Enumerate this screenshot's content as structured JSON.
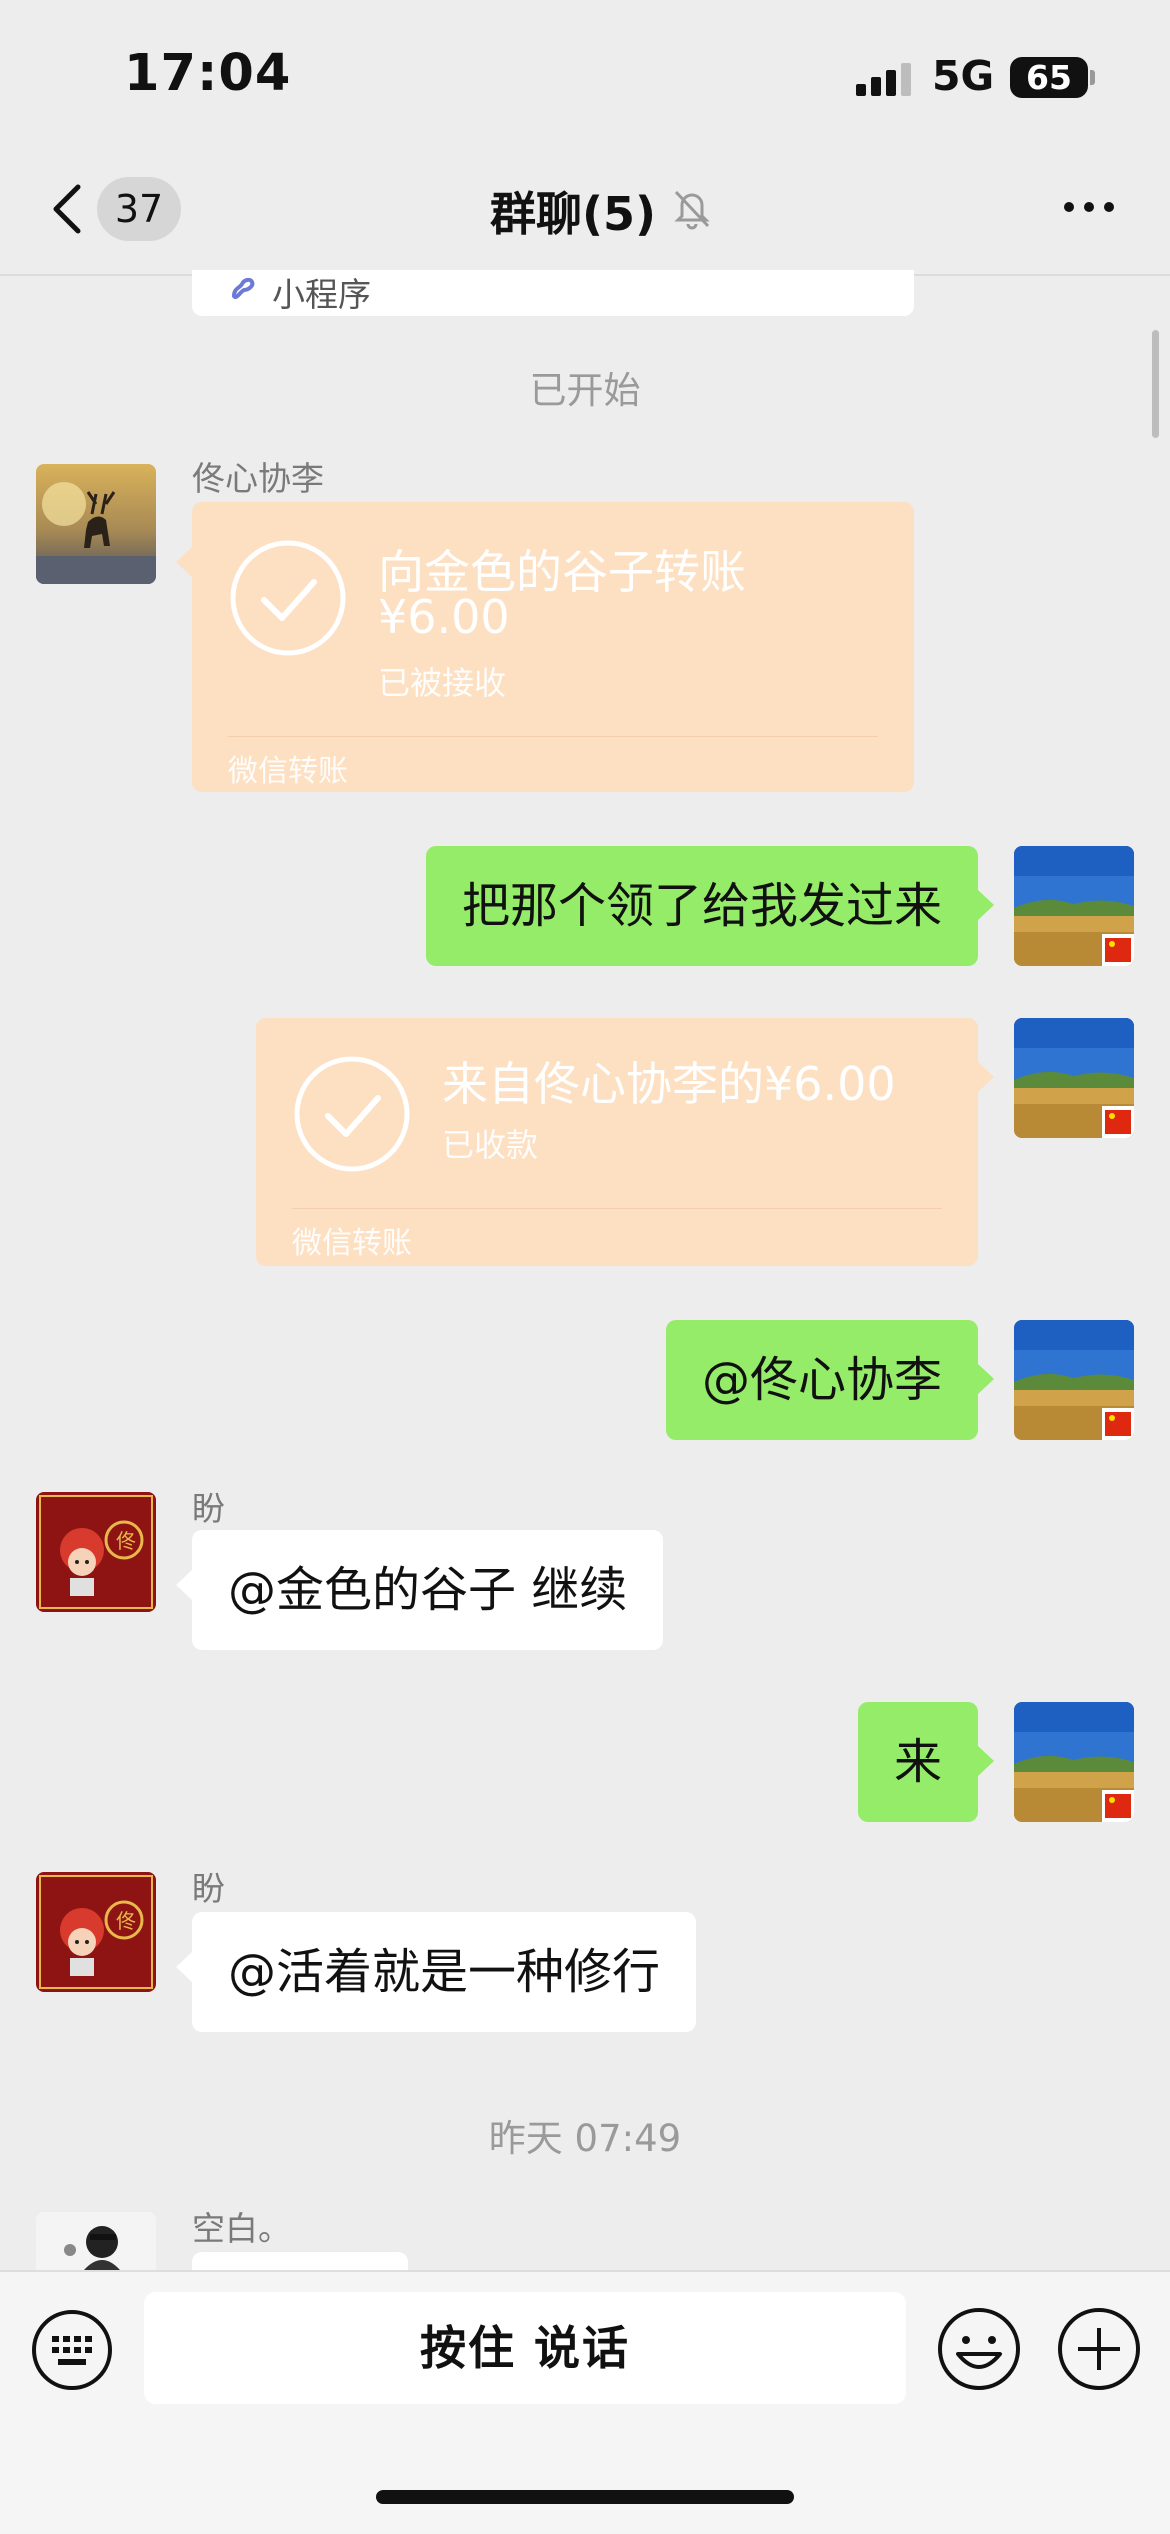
{
  "status_bar": {
    "time": "17:04",
    "network": "5G",
    "battery": "65"
  },
  "nav": {
    "unread_count": "37",
    "title": "群聊(5)"
  },
  "chat": {
    "mini_program_label": "小程序",
    "messages": [
      {
        "type": "system",
        "text": "已开始"
      },
      {
        "type": "transfer",
        "side": "left",
        "sender": "佟心协李",
        "avatar": "deer-avatar",
        "title": "向金色的谷子转账",
        "amount": "¥6.00",
        "status": "已被接收",
        "footer": "微信转账"
      },
      {
        "type": "text",
        "side": "right",
        "avatar": "grassland-avatar",
        "text": "把那个领了给我发过来"
      },
      {
        "type": "transfer",
        "side": "right",
        "avatar": "grassland-avatar",
        "title": "来自佟心协李的¥6.00",
        "status": "已收款",
        "footer": "微信转账"
      },
      {
        "type": "text",
        "side": "right",
        "avatar": "grassland-avatar",
        "text": "@佟心协李"
      },
      {
        "type": "text",
        "side": "left",
        "sender": "盼",
        "avatar": "red-card-avatar",
        "text": "@金色的谷子 继续"
      },
      {
        "type": "text",
        "side": "right",
        "avatar": "grassland-avatar",
        "text": "来"
      },
      {
        "type": "text",
        "side": "left",
        "sender": "盼",
        "avatar": "red-card-avatar",
        "text": "@活着就是一种修行"
      },
      {
        "type": "system",
        "text": "昨天 07:49"
      },
      {
        "type": "text",
        "side": "left",
        "sender": "空白。",
        "avatar": "bearded-man-avatar",
        "text": ""
      }
    ]
  },
  "input_bar": {
    "hold_to_talk_label": "按住 说话"
  },
  "colors": {
    "self_bubble": "#95ec69",
    "transfer_card": "#fddfc2",
    "background": "#ededed"
  }
}
